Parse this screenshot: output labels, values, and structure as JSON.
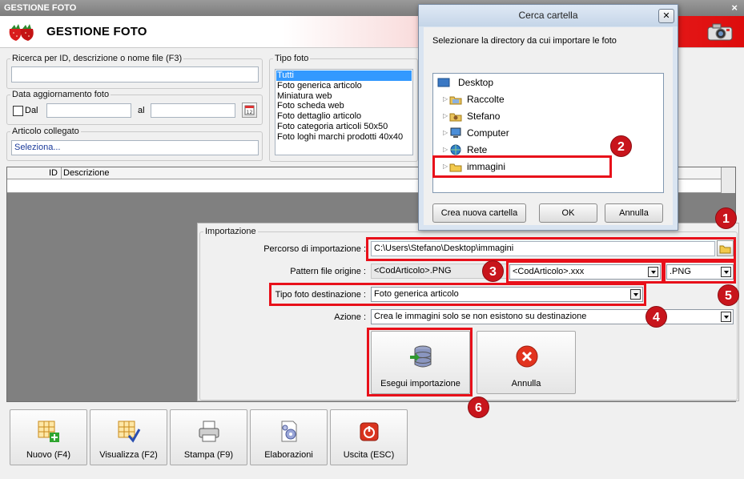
{
  "window": {
    "title": "GESTIONE FOTO",
    "close": "×"
  },
  "header": {
    "title": "GESTIONE FOTO"
  },
  "search": {
    "legend": "Ricerca per ID, descrizione o nome file (F3)",
    "value": ""
  },
  "date": {
    "legend": "Data aggiornamento foto",
    "dal": "Dal",
    "al": "al",
    "from": "",
    "to": ""
  },
  "articolo": {
    "legend": "Articolo collegato",
    "value": "Seleziona..."
  },
  "tipo": {
    "legend": "Tipo foto",
    "items": [
      "Tutti",
      "Foto generica articolo",
      "Miniatura web",
      "Foto scheda web",
      "Foto dettaglio articolo",
      "Foto categoria articoli 50x50",
      "Foto loghi marchi prodotti 40x40"
    ],
    "selected": 0
  },
  "grid": {
    "col_id": "ID",
    "col_desc": "Descrizione"
  },
  "import": {
    "legend": "Importazione",
    "path_label": "Percorso di importazione :",
    "path_value": "C:\\Users\\Stefano\\Desktop\\immagini",
    "pattern_label": "Pattern file origine :",
    "pattern_value": "<CodArticolo>.PNG",
    "pattern_combo": "<CodArticolo>.xxx",
    "ext_combo": ".PNG",
    "tipo_label": "Tipo foto destinazione :",
    "tipo_value": "Foto generica articolo",
    "azione_label": "Azione :",
    "azione_value": "Crea le immagini solo se non esistono su destinazione",
    "run_button": "Esegui importazione",
    "cancel_button": "Annulla"
  },
  "toolbar": {
    "nuovo": "Nuovo (F4)",
    "visualizza": "Visualizza (F2)",
    "stampa": "Stampa (F9)",
    "elaborazioni": "Elaborazioni",
    "uscita": "Uscita (ESC)"
  },
  "dialog": {
    "title": "Cerca cartella",
    "close": "✕",
    "prompt": "Selezionare la directory da cui importare le foto",
    "tree": [
      "Desktop",
      "Raccolte",
      "Stefano",
      "Computer",
      "Rete",
      "immagini"
    ],
    "new_folder": "Crea nuova cartella",
    "ok": "OK",
    "cancel": "Annulla"
  },
  "callouts": [
    "1",
    "2",
    "3",
    "4",
    "5",
    "6"
  ],
  "colors": {
    "callout": "#c8151c",
    "highlight": "#e8101a",
    "selection": "#3399ff"
  }
}
